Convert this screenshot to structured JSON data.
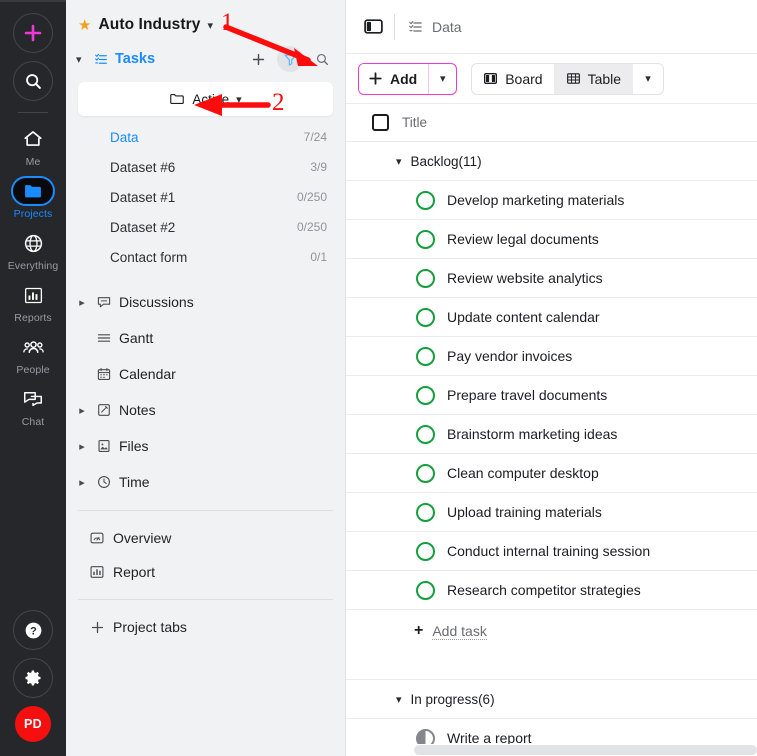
{
  "rail": {
    "add_icon": "plus-icon",
    "search_icon": "search-icon",
    "items": [
      {
        "label": "Me",
        "icon": "home-icon",
        "active": false
      },
      {
        "label": "Projects",
        "icon": "folder-icon",
        "active": true
      },
      {
        "label": "Everything",
        "icon": "globe-icon",
        "active": false
      },
      {
        "label": "Reports",
        "icon": "bar-chart-icon",
        "active": false
      },
      {
        "label": "People",
        "icon": "people-icon",
        "active": false
      },
      {
        "label": "Chat",
        "icon": "chat-icon",
        "active": false
      }
    ],
    "help_icon": "help-icon",
    "settings_icon": "gear-icon",
    "avatar_initials": "PD"
  },
  "sidebar": {
    "project_title": "Auto Industry",
    "tasks_label": "Tasks",
    "add_icon": "plus-icon",
    "filter_icon": "filter-icon",
    "search_icon": "search-icon",
    "active_folder": "Active",
    "task_lists": [
      {
        "name": "Data",
        "count": "7/24",
        "selected": true
      },
      {
        "name": "Dataset #6",
        "count": "3/9",
        "selected": false
      },
      {
        "name": "Dataset #1",
        "count": "0/250",
        "selected": false
      },
      {
        "name": "Dataset #2",
        "count": "0/250",
        "selected": false
      },
      {
        "name": "Contact form",
        "count": "0/1",
        "selected": false
      }
    ],
    "nav": [
      {
        "label": "Discussions",
        "icon": "comment-icon",
        "expandable": true
      },
      {
        "label": "Gantt",
        "icon": "gantt-icon",
        "expandable": false
      },
      {
        "label": "Calendar",
        "icon": "calendar-icon",
        "expandable": false
      },
      {
        "label": "Notes",
        "icon": "note-icon",
        "expandable": true
      },
      {
        "label": "Files",
        "icon": "file-image-icon",
        "expandable": true
      },
      {
        "label": "Time",
        "icon": "clock-icon",
        "expandable": true
      }
    ],
    "footer": [
      {
        "label": "Overview",
        "icon": "gauge-icon"
      },
      {
        "label": "Report",
        "icon": "bar-chart-icon"
      }
    ],
    "project_tabs_label": "Project tabs"
  },
  "main": {
    "panel_toggle_icon": "panel-toggle-icon",
    "breadcrumb_icon": "task-list-icon",
    "breadcrumb_label": "Data",
    "toolbar": {
      "add_label": "Add",
      "add_icon": "plus-icon",
      "add_caret_icon": "chevron-down-icon",
      "board_label": "Board",
      "board_icon": "board-icon",
      "table_label": "Table",
      "table_icon": "table-icon",
      "view_caret_icon": "chevron-down-icon",
      "selected_view": "Table"
    },
    "column_header": {
      "checkbox": "select-all-checkbox",
      "title": "Title"
    },
    "groups": [
      {
        "label": "Backlog(11)",
        "tasks": [
          {
            "name": "Develop marketing materials",
            "status": "open"
          },
          {
            "name": "Review legal documents",
            "status": "open"
          },
          {
            "name": "Review website analytics",
            "status": "open"
          },
          {
            "name": "Update content calendar",
            "status": "open"
          },
          {
            "name": "Pay vendor invoices",
            "status": "open"
          },
          {
            "name": "Prepare travel documents",
            "status": "open"
          },
          {
            "name": "Brainstorm marketing ideas",
            "status": "open"
          },
          {
            "name": "Clean computer desktop",
            "status": "open"
          },
          {
            "name": "Upload training materials",
            "status": "open"
          },
          {
            "name": "Conduct internal training session",
            "status": "open"
          },
          {
            "name": "Research competitor strategies",
            "status": "open"
          }
        ],
        "add_task_label": "Add task"
      },
      {
        "label": "In progress(6)",
        "tasks": [
          {
            "name": "Write a report",
            "status": "in-progress"
          }
        ]
      }
    ]
  },
  "annotations": {
    "color": "#fc0d0d",
    "markers": [
      {
        "number": "1",
        "target": "filter-icon"
      },
      {
        "number": "2",
        "target": "active-folder-dropdown"
      }
    ]
  },
  "colors": {
    "accent_blue": "#1a8cff",
    "accent_magenta": "#ef39d6",
    "status_green": "#149e3e",
    "avatar_red": "#f5100f",
    "star_orange": "#f5a020",
    "annotation_red": "#fc0d0d"
  }
}
